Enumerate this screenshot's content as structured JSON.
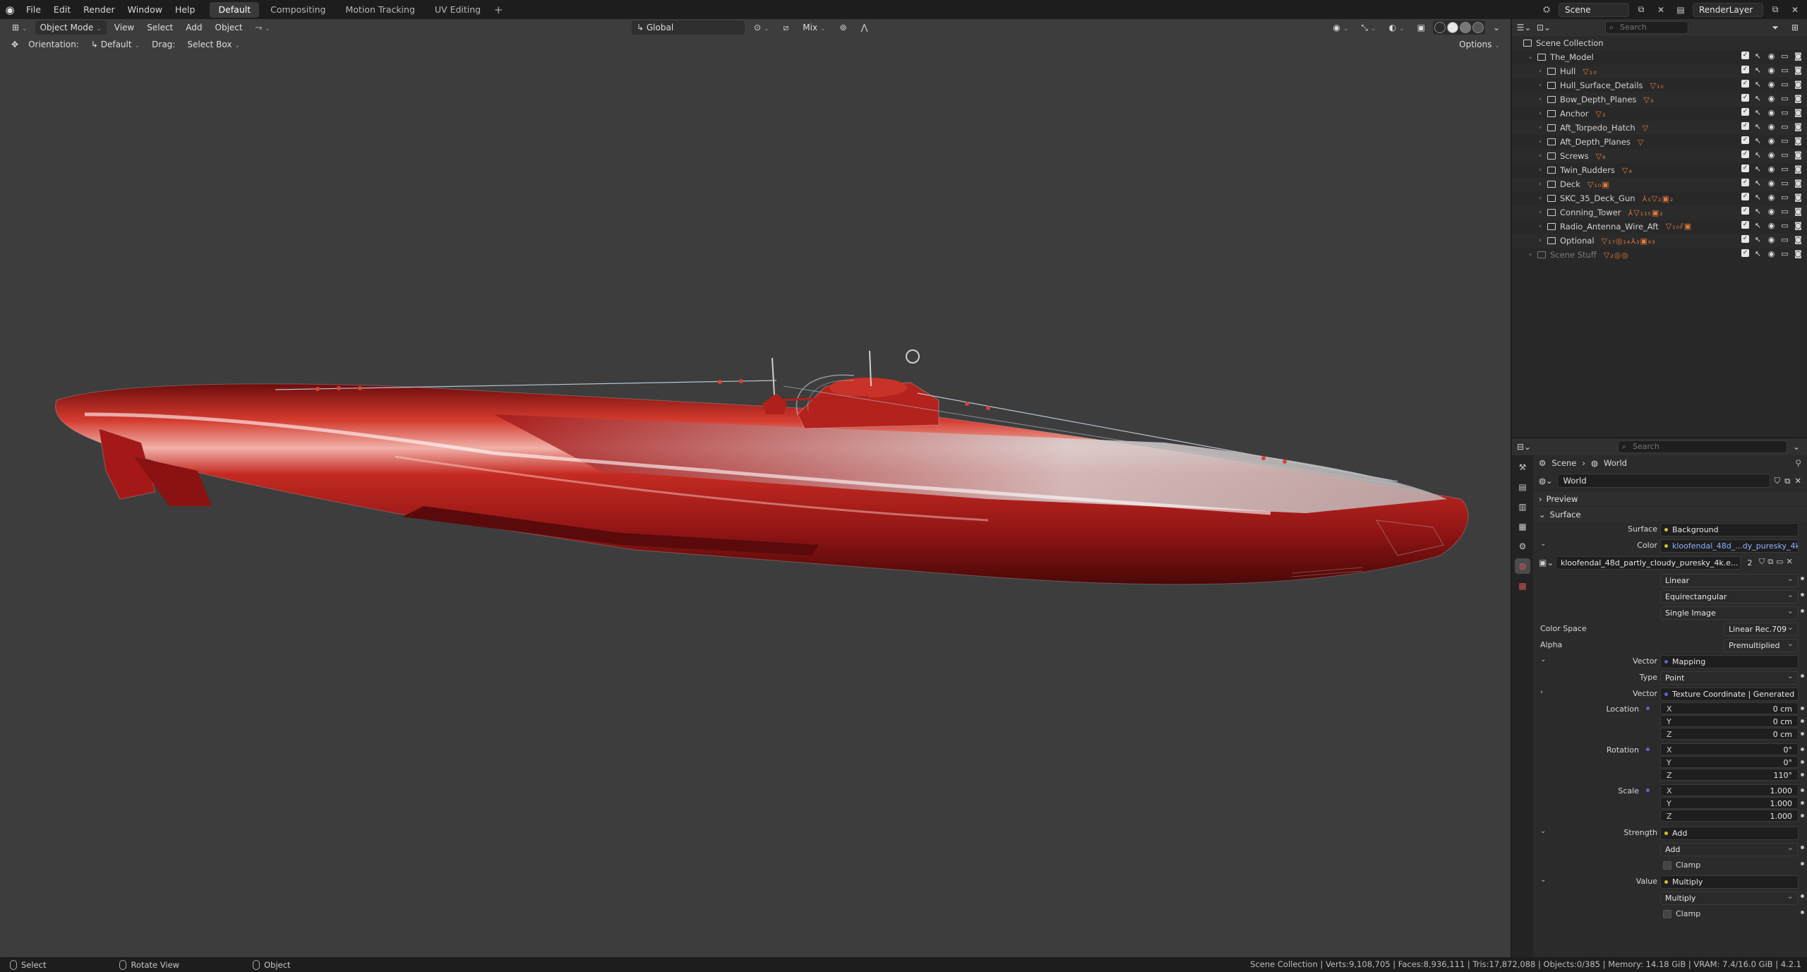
{
  "menu": [
    "File",
    "Edit",
    "Render",
    "Window",
    "Help"
  ],
  "workspaces": [
    {
      "label": "Default",
      "active": true
    },
    {
      "label": "Compositing",
      "active": false
    },
    {
      "label": "Motion Tracking",
      "active": false
    },
    {
      "label": "UV Editing",
      "active": false
    }
  ],
  "topbar": {
    "scene": "Scene",
    "render_layer": "RenderLayer"
  },
  "viewport": {
    "mode": "Object Mode",
    "menus": [
      "View",
      "Select",
      "Add",
      "Object"
    ],
    "transform_orientation": "Global",
    "snap_mode": "Mix",
    "orientation_label": "Orientation:",
    "orientation_value": "Default",
    "drag_label": "Drag:",
    "drag_value": "Select Box",
    "options_label": "Options"
  },
  "status": {
    "select": "Select",
    "rotate": "Rotate View",
    "object": "Object",
    "stats": "Scene Collection | Verts:9,108,705 | Faces:8,936,111 | Tris:17,872,088 | Objects:0/385 | Memory: 14.18 GiB | VRAM: 7.4/16.0 GiB | 4.2.1"
  },
  "outliner": {
    "search_placeholder": "Search",
    "root": "Scene Collection",
    "parent": "The_Model",
    "items": [
      {
        "name": "Hull",
        "mods": "▽₁₀"
      },
      {
        "name": "Hull_Surface_Details",
        "mods": "▽₁₀"
      },
      {
        "name": "Bow_Depth_Planes",
        "mods": "▽₃"
      },
      {
        "name": "Anchor",
        "mods": "▽₂"
      },
      {
        "name": "Aft_Torpedo_Hatch",
        "mods": "▽"
      },
      {
        "name": "Aft_Depth_Planes",
        "mods": "▽"
      },
      {
        "name": "Screws",
        "mods": "▽₈"
      },
      {
        "name": "Twin_Rudders",
        "mods": "▽₄"
      },
      {
        "name": "Deck",
        "mods": "▽₁₀▣"
      },
      {
        "name": "SKC_35_Deck_Gun",
        "mods": "⅄₅▽₂▣₂"
      },
      {
        "name": "Conning_Tower",
        "mods": "⅄▽₁₁₅▣₂"
      },
      {
        "name": "Radio_Antenna_Wire_Aft",
        "mods": "▽₁₀⫽▣"
      },
      {
        "name": "Optional",
        "mods": "▽₁₇◎₁₄⅄₃▣₆₃"
      }
    ],
    "extra": {
      "name": "Scene Stuff",
      "mods": "▽₂◎◎"
    }
  },
  "properties": {
    "search_placeholder": "Search",
    "breadcrumb": [
      "Scene",
      "World"
    ],
    "world_name": "World",
    "panels": {
      "preview": "Preview",
      "surface": "Surface"
    },
    "surface": "Background",
    "color": "kloofendal_48d_...dy_puresky_4k.exr",
    "image_name": "kloofendal_48d_partly_cloudy_puresky_4k.e...",
    "image_users": "2",
    "interpolation": "Linear",
    "projection": "Equirectangular",
    "source": "Single Image",
    "color_space_label": "Color Space",
    "color_space": "Linear Rec.709",
    "alpha_label": "Alpha",
    "alpha": "Premultiplied",
    "vector_label": "Vector",
    "vector": "Mapping",
    "type_label": "Type",
    "type": "Point",
    "vector2": "Texture Coordinate | Generated",
    "location_label": "Location",
    "location": {
      "x": "0 cm",
      "y": "0 cm",
      "z": "0 cm"
    },
    "rotation_label": "Rotation",
    "rotation": {
      "x": "0°",
      "y": "0°",
      "z": "110°"
    },
    "scale_label": "Scale",
    "scale": {
      "x": "1.000",
      "y": "1.000",
      "z": "1.000"
    },
    "strength_label": "Strength",
    "strength": "Add",
    "strength_op": "Add",
    "clamp": "Clamp",
    "value_label": "Value",
    "value": "Multiply",
    "value_op": "Multiply",
    "labels": {
      "surface": "Surface",
      "color": "Color",
      "x": "X",
      "y": "Y",
      "z": "Z"
    }
  },
  "colors": {
    "accent": "#4772b3",
    "hull_red": "#b01a1a",
    "modifier_orange": "#e07a3a"
  }
}
